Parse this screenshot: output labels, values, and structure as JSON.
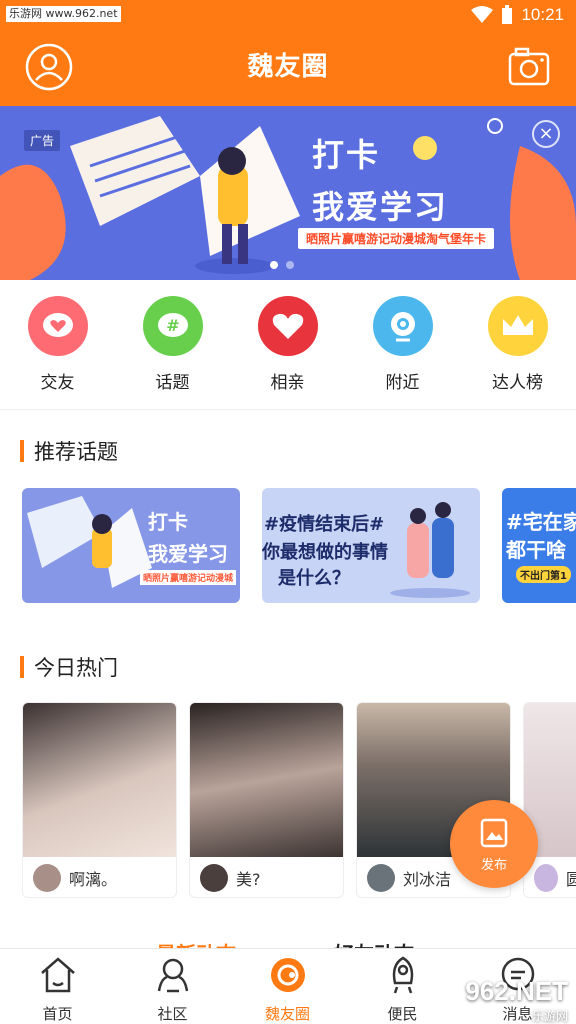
{
  "status": {
    "watermark": "乐游网 www.962.net",
    "time": "10:21"
  },
  "header": {
    "title": "魏友圈"
  },
  "banner": {
    "ad_label": "广告",
    "close": "×",
    "headline1": "打卡",
    "headline2": "我爱学习",
    "subtitle": "晒照片赢嘻游记动漫城淘气堡年卡"
  },
  "quicknav": [
    {
      "label": "交友",
      "icon": "heart-chat-icon",
      "color": "#ff6b73"
    },
    {
      "label": "话题",
      "icon": "hashtag-icon",
      "color": "#68cf4d"
    },
    {
      "label": "相亲",
      "icon": "heart-icon",
      "color": "#e8343d"
    },
    {
      "label": "附近",
      "icon": "location-icon",
      "color": "#4cb7ec"
    },
    {
      "label": "达人榜",
      "icon": "crown-icon",
      "color": "#ffd33b"
    }
  ],
  "sections": {
    "topics": "推荐话题",
    "hot": "今日热门"
  },
  "topics": [
    {
      "line1": "打卡",
      "line2": "我爱学习",
      "line3": "晒照片赢嘻游记动漫城",
      "bg": "#8797e8"
    },
    {
      "line1": "#疫情结束后#",
      "line2": "你最想做的事情",
      "line3": "是什么？",
      "bg": "#c8d4f5"
    },
    {
      "line1": "#宅在家",
      "line2": "都干啥",
      "line3": "不出门第1",
      "bg": "#3a7de8"
    }
  ],
  "hot": [
    {
      "name": "啊漓。",
      "photo_bg": "#d7c7c0"
    },
    {
      "name": "美?",
      "photo_bg": "#9f8c84"
    },
    {
      "name": "刘冰洁",
      "photo_bg": "#8f9aa2"
    },
    {
      "name": "圆",
      "photo_bg": "#e7dde0"
    }
  ],
  "publish": {
    "label": "发布"
  },
  "feed_tabs": [
    "最新动态",
    "好友动态"
  ],
  "bottom_nav": [
    {
      "label": "首页",
      "icon": "home-icon",
      "active": false
    },
    {
      "label": "社区",
      "icon": "community-icon",
      "active": false
    },
    {
      "label": "魏友圈",
      "icon": "circle-icon",
      "active": true
    },
    {
      "label": "便民",
      "icon": "rocket-icon",
      "active": false
    },
    {
      "label": "消息",
      "icon": "message-icon",
      "active": false
    }
  ],
  "site_watermark": {
    "brand": "962.NET",
    "sub": "乐游网"
  }
}
